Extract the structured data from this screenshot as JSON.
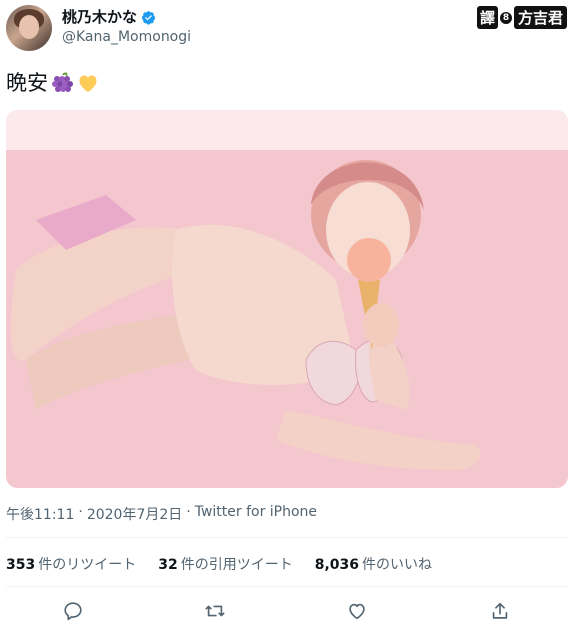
{
  "author": {
    "name": "桃乃木かな",
    "handle": "@Kana_Momonogi",
    "verified_icon": "verified-badge-icon"
  },
  "watermark": {
    "part1": "譯",
    "part2": "8",
    "part3": "方吉君"
  },
  "tweet": {
    "text": "晩安",
    "emojis": [
      "grapes-icon",
      "yellow-heart-icon"
    ]
  },
  "meta": {
    "time": "午後11:11",
    "sep1": "·",
    "date": "2020年7月2日",
    "sep2": "·",
    "source": "Twitter for iPhone"
  },
  "stats": {
    "retweets_count": "353",
    "retweets_label": "件のリツイート",
    "quotes_count": "32",
    "quotes_label": "件の引用ツイート",
    "likes_count": "8,036",
    "likes_label": "件のいいね"
  },
  "actions": [
    "reply-icon",
    "retweet-icon",
    "like-icon",
    "share-icon"
  ],
  "colors": {
    "verified": "#1d9bf0",
    "secondary_text": "#536471",
    "photo_pink": "#f6cdd4"
  }
}
